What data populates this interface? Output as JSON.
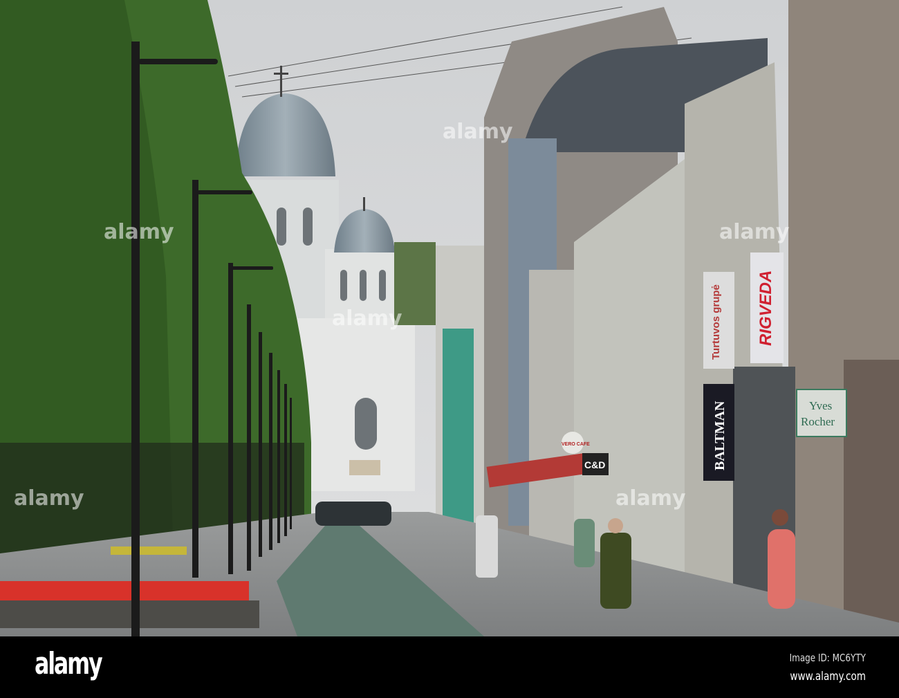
{
  "photo": {
    "signs": {
      "rigveda": "RIGVEDA",
      "turtuvos": "Turtuvos grupė",
      "baltman": "BALTMAN",
      "yves_rocher_1": "Yves",
      "yves_rocher_2": "Rocher",
      "cd": "C&D",
      "vero_cafe": "VERO CAFE"
    },
    "watermark": "alamy",
    "colors": {
      "sky": "#d3d5d7",
      "trees": "#3f6b2a",
      "dome": "#8c9aa3",
      "flowers": "#d8322a",
      "bike_lane": "#5f7a70"
    }
  },
  "footer": {
    "logo": "alamy",
    "image_id": "Image ID: MC6YTY",
    "website": "www.alamy.com"
  }
}
